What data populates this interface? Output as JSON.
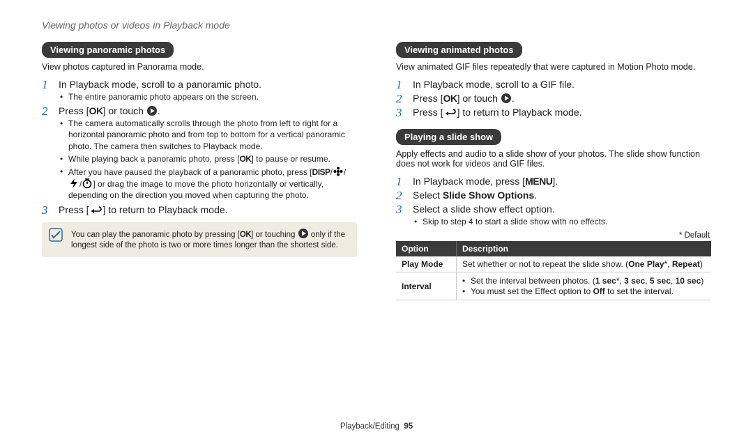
{
  "page_title": "Viewing photos or videos in Playback mode",
  "left": {
    "heading": "Viewing panoramic photos",
    "intro": "View photos captured in Panorama mode.",
    "s1": "In Playback mode, scroll to a panoramic photo.",
    "s1b": "The entire panoramic photo appears on the screen.",
    "s2a": "Press [",
    "s2b": "] or touch ",
    "s2c": ".",
    "s2sub1a": "The camera automatically scrolls through the photo from left to right for a horizontal panoramic photo and from top to bottom for a vertical panoramic photo. The camera then switches to Playback mode.",
    "s2sub2a": "While playing back a panoramic photo, press [",
    "s2sub2b": "] to pause or resume.",
    "s2sub3a": "After you have paused the playback of a panoramic photo, press [",
    "s2sub3b": "] or drag the image to move the photo horizontally or vertically, depending on the direction you moved when capturing the photo.",
    "s3a": "Press [",
    "s3b": "] to return to Playback mode.",
    "note_a": "You can play the panoramic photo by pressing [",
    "note_b": "] or touching ",
    "note_c": " only if the longest side of the photo is two or more times longer than the shortest side."
  },
  "right": {
    "h1": "Viewing animated photos",
    "intro1": "View animated GIF files repeatedly that were captured in Motion Photo mode.",
    "r1": "In Playback mode, scroll to a GIF file.",
    "r2a": "Press [",
    "r2b": "] or touch ",
    "r2c": ".",
    "r3a": "Press [",
    "r3b": "] to return to Playback mode.",
    "h2": "Playing a slide show",
    "intro2": "Apply effects and audio to a slide show of your photos. The slide show function does not work for videos and GIF files.",
    "p1a": "In Playback mode, press [",
    "p1b": "].",
    "p2a": "Select ",
    "p2b": "Slide Show Options",
    "p2c": ".",
    "p3": "Select a slide show effect option.",
    "p3sub": "Skip to step 4 to start a slide show with no effects.",
    "default_label": "* Default",
    "table": {
      "h_option": "Option",
      "h_desc": "Description",
      "row1_opt": "Play Mode",
      "row1_a": "Set whether or not to repeat the slide show. (",
      "row1_b": "One Play",
      "row1_c": "*, ",
      "row1_d": "Repeat",
      "row1_e": ")",
      "row2_opt": "Interval",
      "row2_l1a": "Set the interval between photos. (",
      "row2_l1b": "1 sec",
      "row2_l1c": "*, ",
      "row2_l1d": "3 sec",
      "row2_l1e": ", ",
      "row2_l1f": "5 sec",
      "row2_l1g": ", ",
      "row2_l1h": "10 sec",
      "row2_l1i": ")",
      "row2_l2a": "You must set the Effect option to ",
      "row2_l2b": "Off",
      "row2_l2c": " to set the interval."
    }
  },
  "footer_section": "Playback/Editing",
  "footer_page": "95",
  "glyph": {
    "ok": "OK",
    "disp": "DISP",
    "menu": "MENU"
  }
}
